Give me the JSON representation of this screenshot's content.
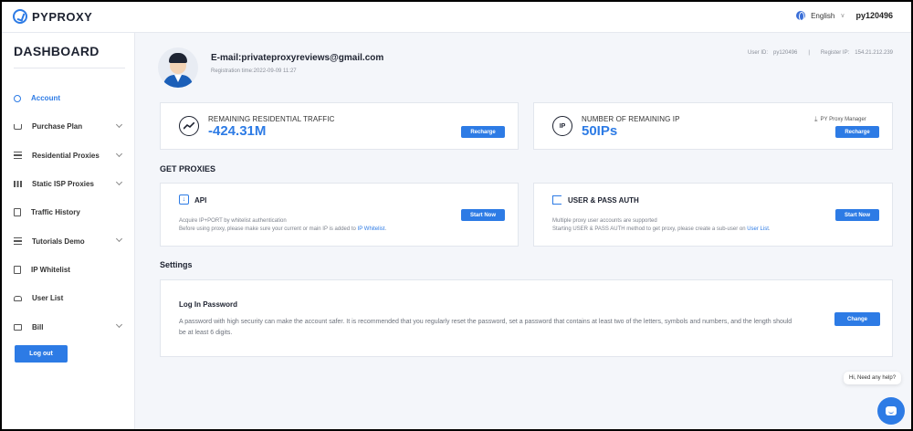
{
  "topbar": {
    "brand": "PYPROXY",
    "language": "English",
    "username": "py120496"
  },
  "sidebar": {
    "title": "DASHBOARD",
    "items": [
      {
        "label": "Account",
        "icon": "user-icon",
        "active": true,
        "expandable": false
      },
      {
        "label": "Purchase Plan",
        "icon": "cart-icon",
        "active": false,
        "expandable": true
      },
      {
        "label": "Residential Proxies",
        "icon": "list-icon",
        "active": false,
        "expandable": true
      },
      {
        "label": "Static ISP Proxies",
        "icon": "grid-icon",
        "active": false,
        "expandable": true
      },
      {
        "label": "Traffic History",
        "icon": "document-icon",
        "active": false,
        "expandable": false
      },
      {
        "label": "Tutorials Demo",
        "icon": "list-icon",
        "active": false,
        "expandable": true
      },
      {
        "label": "IP Whitelist",
        "icon": "document-icon",
        "active": false,
        "expandable": false
      },
      {
        "label": "User List",
        "icon": "car-icon",
        "active": false,
        "expandable": false
      },
      {
        "label": "Bill",
        "icon": "wallet-icon",
        "active": false,
        "expandable": true
      }
    ],
    "logout_label": "Log out"
  },
  "profile": {
    "email": "E-mail:privateproxyreviews@gmail.com",
    "registration": "Registration time:2022-09-09 11:27",
    "user_id_label": "User ID:",
    "user_id": "py120496",
    "separator": "|",
    "register_ip_label": "Register IP:",
    "register_ip": "154.21.212.239"
  },
  "traffic": {
    "label": "REMAINING RESIDENTIAL TRAFFIC",
    "value": "-424.31M",
    "button": "Recharge"
  },
  "remaining_ip": {
    "label": "NUMBER OF REMAINING IP",
    "value": "50IPs",
    "icon_text": "IP",
    "manager_link": "PY Proxy Manager",
    "button": "Recharge"
  },
  "get_proxies": {
    "title": "GET PROXIES",
    "api": {
      "title": "API",
      "line1": "Acquire IP+PORT by whitelist authentication",
      "line2_prefix": "Before using proxy, please make sure your current or main IP is added to ",
      "line2_link": "IP Whitelist",
      "line2_suffix": ".",
      "button": "Start Now"
    },
    "userpass": {
      "title": "USER & PASS AUTH",
      "line1": "Multiple proxy user accounts are supported",
      "line2_prefix": "Starting USER & PASS AUTH method to get proxy, please create a sub-user on ",
      "line2_link": "User List",
      "line2_suffix": ".",
      "button": "Start Now"
    }
  },
  "settings": {
    "title": "Settings",
    "password_title": "Log In Password",
    "password_text": "A password with high security can make the account safer. It is recommended that you regularly reset the password, set a password that contains at least two of the letters, symbols and numbers, and the length should be at least 6 digits.",
    "button": "Change"
  },
  "chat": {
    "bubble": "Hi, Need any help?"
  },
  "colors": {
    "accent": "#2d7be5",
    "text_dark": "#1d2230",
    "background": "#f4f6fa"
  }
}
